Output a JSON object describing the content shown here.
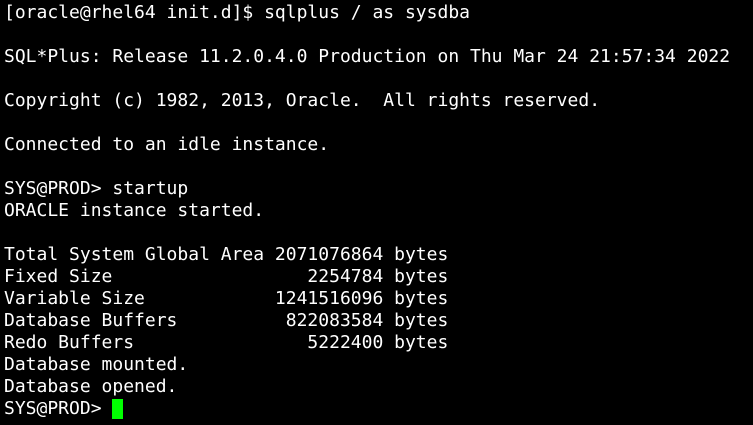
{
  "terminal": {
    "lines": [
      "[oracle@rhel64 init.d]$ sqlplus / as sysdba",
      "",
      "SQL*Plus: Release 11.2.0.4.0 Production on Thu Mar 24 21:57:34 2022",
      "",
      "Copyright (c) 1982, 2013, Oracle.  All rights reserved.",
      "",
      "Connected to an idle instance.",
      "",
      "SYS@PROD> startup",
      "ORACLE instance started.",
      "",
      "Total System Global Area 2071076864 bytes",
      "Fixed Size                  2254784 bytes",
      "Variable Size            1241516096 bytes",
      "Database Buffers          822083584 bytes",
      "Redo Buffers                5222400 bytes",
      "Database mounted.",
      "Database opened."
    ],
    "prompt": "SYS@PROD> ",
    "cursor_color": "#00ff00",
    "background_color": "#000000",
    "text_color": "#ffffff"
  }
}
